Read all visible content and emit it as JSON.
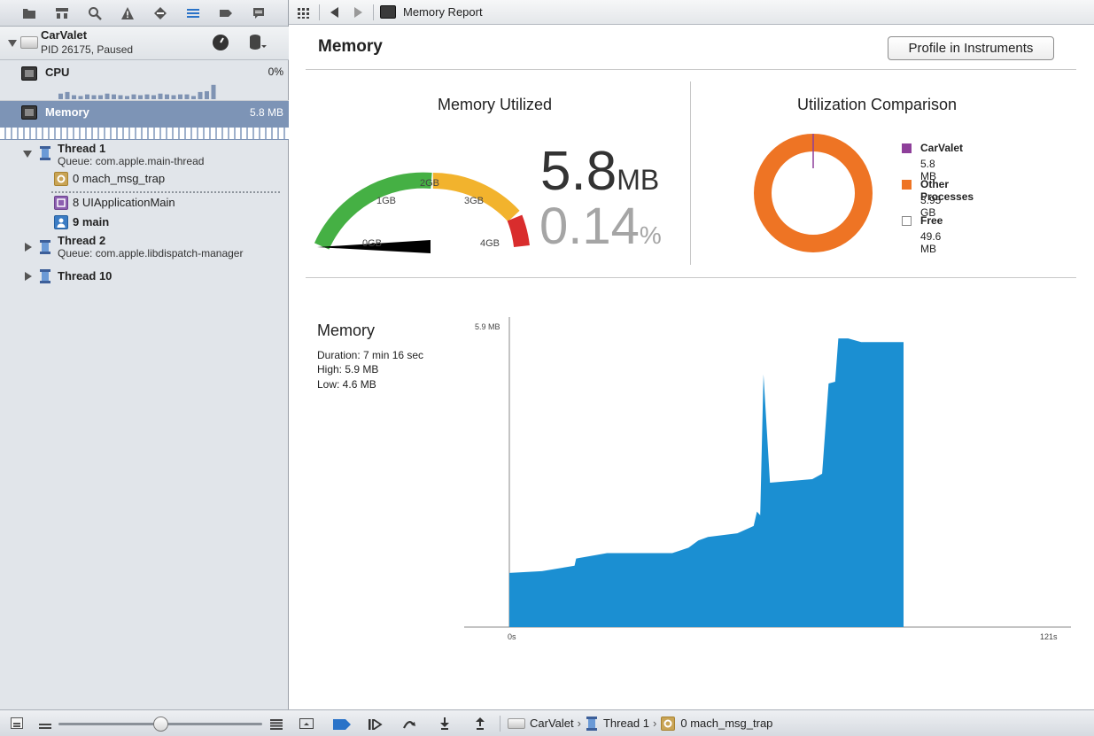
{
  "sidebar": {
    "process": {
      "name": "CarValet",
      "status": "PID 26175, Paused"
    },
    "cpu": {
      "label": "CPU",
      "value": "0%",
      "bars": [
        0.35,
        0.45,
        0.25,
        0.2,
        0.3,
        0.25,
        0.25,
        0.35,
        0.3,
        0.25,
        0.2,
        0.3,
        0.25,
        0.3,
        0.25,
        0.35,
        0.3,
        0.25,
        0.3,
        0.3,
        0.2,
        0.45,
        0.5,
        0.9
      ]
    },
    "memory": {
      "label": "Memory",
      "value": "5.8 MB"
    },
    "thread1": {
      "name": "Thread 1",
      "queue": "Queue: com.apple.main-thread"
    },
    "frames": [
      {
        "label": "0 mach_msg_trap",
        "icon": "gear-frame-icon",
        "color": "#c9a455"
      },
      {
        "label": "8 UIApplicationMain",
        "icon": "framework-frame-icon",
        "color": "#8c5fb0"
      },
      {
        "label": "9 main",
        "icon": "user-frame-icon",
        "color": "#3b7cc4"
      }
    ],
    "thread2": {
      "name": "Thread 2",
      "queue": "Queue: com.apple.libdispatch-manager"
    },
    "thread10": {
      "name": "Thread 10"
    }
  },
  "jumpbar": {
    "title": "Memory Report"
  },
  "report": {
    "title": "Memory",
    "profile_button": "Profile in Instruments",
    "utilized": {
      "title": "Memory Utilized",
      "value": "5.8",
      "unit": "MB",
      "percent": "0.14",
      "percent_unit": "%",
      "gauge_labels": [
        "0GB",
        "1GB",
        "2GB",
        "3GB",
        "4GB"
      ],
      "gauge_value_fraction": 0.0014
    },
    "comparison": {
      "title": "Utilization Comparison",
      "legend": [
        {
          "name": "CarValet",
          "value": "5.8 MB",
          "color": "#8e3f9a"
        },
        {
          "name": "Other Processes",
          "value": "3.95 GB",
          "color": "#ee7424"
        },
        {
          "name": "Free",
          "value": "49.6 MB",
          "color": "#ffffff"
        }
      ]
    },
    "history": {
      "title": "Memory",
      "duration": "Duration: 7 min 16 sec",
      "high": "High: 5.9 MB",
      "low": "Low: 4.6 MB"
    }
  },
  "chart_data": {
    "type": "area",
    "ylabel_max": "5.9 MB",
    "x_start_label": "0s",
    "x_end_label": "121s",
    "color": "#1b8fd2",
    "ylim": [
      0,
      5.9
    ],
    "xlim": [
      0,
      121
    ],
    "x": [
      0,
      10,
      20,
      20.5,
      30,
      40,
      50,
      55,
      58,
      61,
      70,
      75,
      76,
      77,
      78,
      80,
      93,
      96,
      98,
      100,
      101,
      104,
      108,
      121
    ],
    "values": [
      4.6,
      4.61,
      4.64,
      4.68,
      4.71,
      4.71,
      4.71,
      4.74,
      4.78,
      4.8,
      4.82,
      4.86,
      4.94,
      4.92,
      5.7,
      5.1,
      5.12,
      5.15,
      5.65,
      5.66,
      5.9,
      5.9,
      5.88,
      5.88
    ]
  },
  "debugbar": {
    "crumb_process": "CarValet",
    "crumb_thread": "Thread 1",
    "crumb_frame": "0 mach_msg_trap"
  }
}
